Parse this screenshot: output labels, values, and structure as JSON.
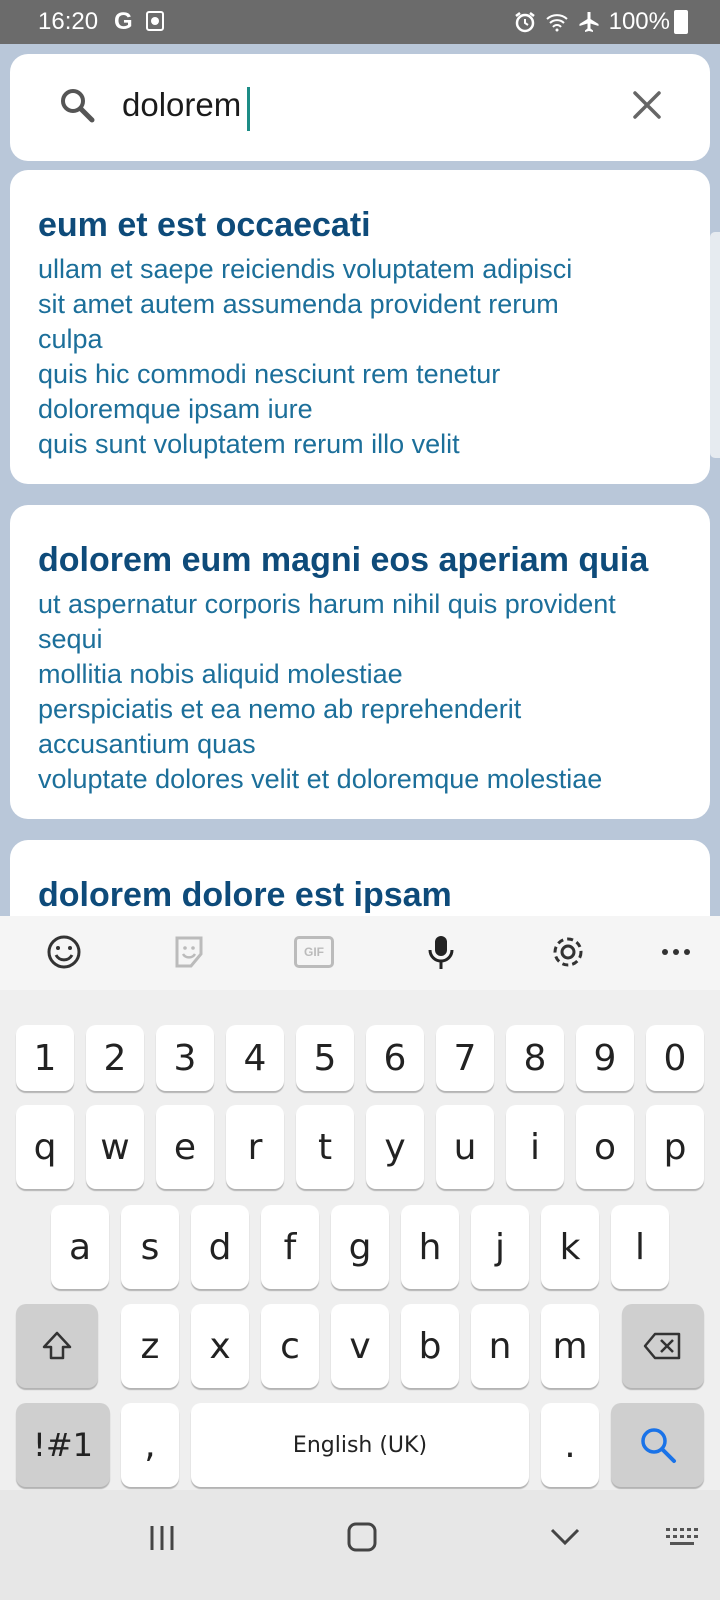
{
  "status_bar": {
    "time": "16:20",
    "notif_g": "G",
    "battery": "100%",
    "icons": [
      "alarm-icon",
      "wifi-icon",
      "airplane-icon",
      "battery-icon"
    ]
  },
  "search": {
    "value": "dolorem",
    "icon": "search-icon",
    "clear_icon": "close-icon"
  },
  "results": [
    {
      "title": "eum et est occaecati",
      "lines": [
        "ullam et saepe reiciendis voluptatem adipisci",
        "sit amet autem assumenda provident rerum",
        "culpa",
        "quis hic commodi nesciunt rem tenetur",
        "doloremque ipsam iure",
        "quis sunt voluptatem rerum illo velit"
      ]
    },
    {
      "title": "dolorem eum magni eos aperiam quia",
      "lines": [
        "ut aspernatur corporis harum nihil quis provident",
        "sequi",
        "mollitia nobis aliquid molestiae",
        "perspiciatis et ea nemo ab reprehenderit",
        "accusantium quas",
        "voluptate dolores velit et doloremque molestiae"
      ]
    },
    {
      "title": "dolorem dolore est ipsam",
      "lines": []
    }
  ],
  "keyboard": {
    "toolbar": [
      "emoji-icon",
      "sticker-icon",
      "gif-icon",
      "microphone-icon",
      "settings-icon",
      "more-icon"
    ],
    "gif_label": "GIF",
    "row_numbers": [
      "1",
      "2",
      "3",
      "4",
      "5",
      "6",
      "7",
      "8",
      "9",
      "0"
    ],
    "row_q": [
      "q",
      "w",
      "e",
      "r",
      "t",
      "y",
      "u",
      "i",
      "o",
      "p"
    ],
    "row_a": [
      "a",
      "s",
      "d",
      "f",
      "g",
      "h",
      "j",
      "k",
      "l"
    ],
    "row_z": [
      "z",
      "x",
      "c",
      "v",
      "b",
      "n",
      "m"
    ],
    "symbols_label": "!#1",
    "comma_label": ",",
    "space_label": "English (UK)",
    "period_label": ".",
    "accent_color": "#1a73e8"
  },
  "nav_bar": {
    "buttons": [
      "recent-apps-icon",
      "home-icon",
      "back-icon",
      "keyboard-switch-icon"
    ]
  }
}
